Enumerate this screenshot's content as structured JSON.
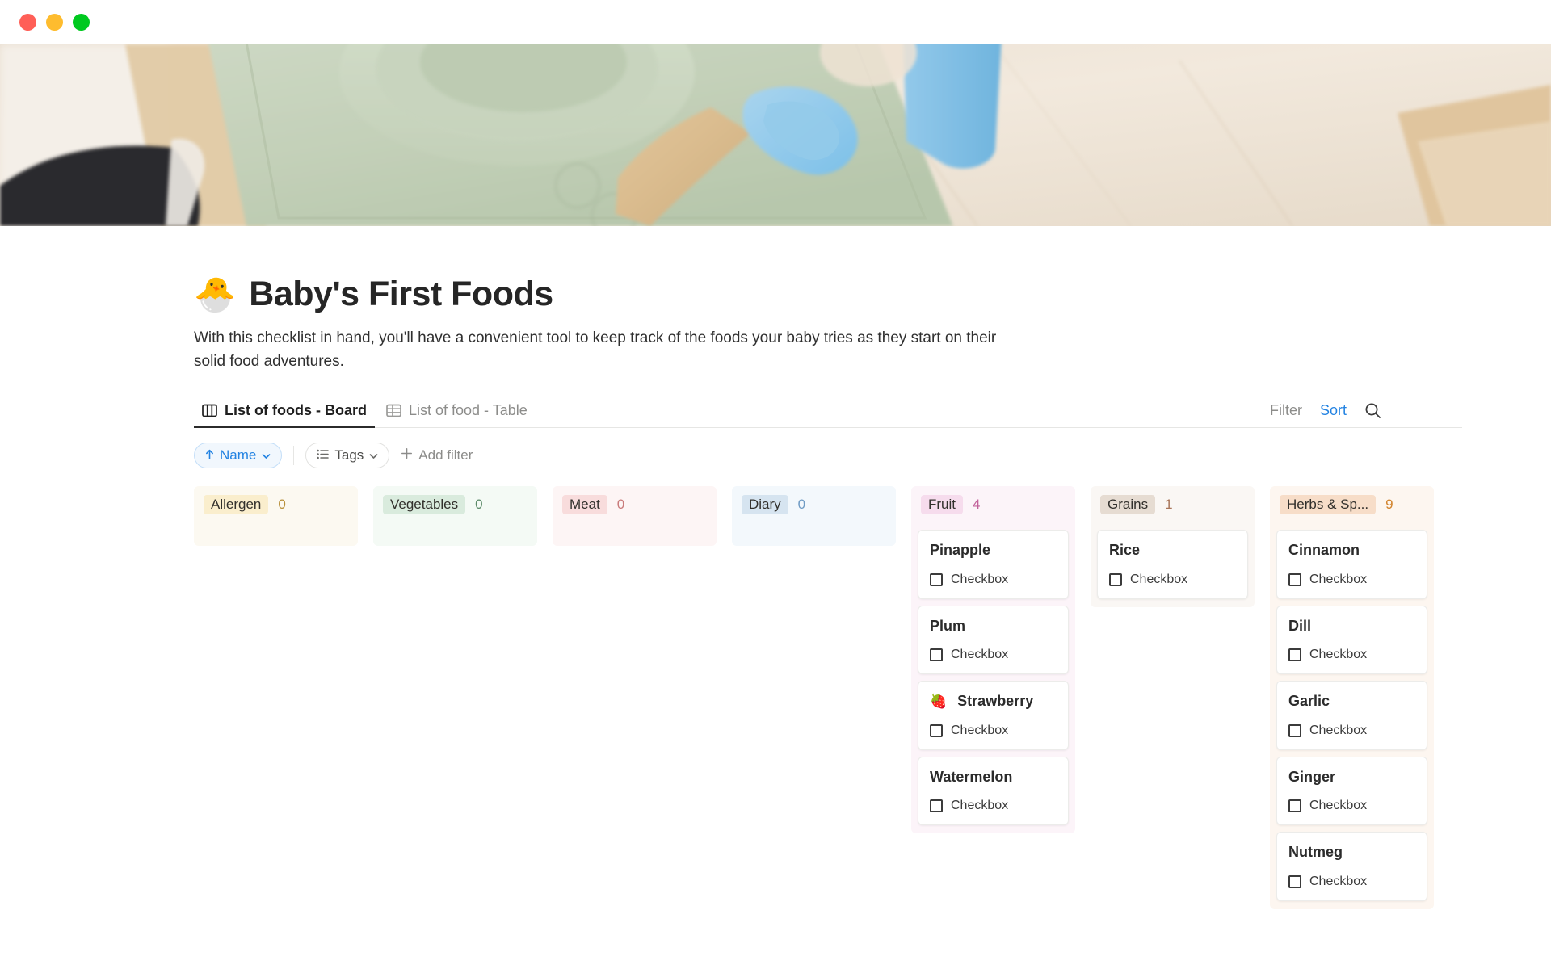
{
  "window": {
    "traffic_lights": [
      {
        "name": "close",
        "color": "#ff5f57"
      },
      {
        "name": "minimize",
        "color": "#febc2e"
      },
      {
        "name": "maximize",
        "color": "#00c91f"
      }
    ]
  },
  "header": {
    "emoji": "🐣",
    "title": "Baby's First Foods",
    "description": "With this checklist in hand, you'll have a convenient tool to keep track of the foods your baby tries as they start on their solid food adventures."
  },
  "tabs": [
    {
      "label": "List of foods - Board",
      "icon": "board-icon",
      "active": true
    },
    {
      "label": "List of food - Table",
      "icon": "table-icon",
      "active": false
    }
  ],
  "view_actions": {
    "filter_label": "Filter",
    "sort_label": "Sort",
    "search_icon": "search-icon",
    "accent_color": "#2383e2"
  },
  "filter_bar": {
    "sort_pill": {
      "label": "Name",
      "prefix_icon": "arrow-up-icon",
      "suffix_icon": "chevron-down-icon"
    },
    "group_pill": {
      "label": "Tags",
      "prefix_icon": "list-icon",
      "suffix_icon": "chevron-down-icon"
    },
    "add_filter": {
      "label": "Add filter",
      "icon": "plus-icon"
    }
  },
  "board": {
    "checkbox_label": "Checkbox",
    "columns": [
      {
        "name": "Allergen",
        "count": "0",
        "chip_bg": "#faeecd",
        "count_color": "#b8903a",
        "head_bg": "#fcf9f1",
        "body_bg": "#fcf9f1",
        "cards": []
      },
      {
        "name": "Vegetables",
        "count": "0",
        "chip_bg": "#d9ebdd",
        "count_color": "#5c8a69",
        "head_bg": "#f4faf5",
        "body_bg": "#f4faf5",
        "cards": []
      },
      {
        "name": "Meat",
        "count": "0",
        "chip_bg": "#f8dcdc",
        "count_color": "#c97b7b",
        "head_bg": "#fdf5f5",
        "body_bg": "#fdf5f5",
        "cards": []
      },
      {
        "name": "Diary",
        "count": "0",
        "chip_bg": "#d6e4f0",
        "count_color": "#6f9bc4",
        "head_bg": "#f3f8fc",
        "body_bg": "#f3f8fc",
        "cards": []
      },
      {
        "name": "Fruit",
        "count": "4",
        "chip_bg": "#f6dced",
        "count_color": "#c2629b",
        "head_bg": "#fcf4f9",
        "body_bg": "#fcf4f9",
        "cards": [
          {
            "title": "Pinapple",
            "emoji": ""
          },
          {
            "title": "Plum",
            "emoji": ""
          },
          {
            "title": "Strawberry",
            "emoji": "🍓"
          },
          {
            "title": "Watermelon",
            "emoji": ""
          }
        ]
      },
      {
        "name": "Grains",
        "count": "1",
        "chip_bg": "#e6dcd2",
        "count_color": "#a9765a",
        "head_bg": "#faf7f4",
        "body_bg": "#faf7f4",
        "cards": [
          {
            "title": "Rice",
            "emoji": ""
          }
        ]
      },
      {
        "name": "Herbs & Sp...",
        "count": "9",
        "chip_bg": "#f7ddc8",
        "count_color": "#d2842e",
        "head_bg": "#fdf6f0",
        "body_bg": "#fdf6f0",
        "cards": [
          {
            "title": "Cinnamon",
            "emoji": ""
          },
          {
            "title": "Dill",
            "emoji": ""
          },
          {
            "title": "Garlic",
            "emoji": ""
          },
          {
            "title": "Ginger",
            "emoji": ""
          },
          {
            "title": "Nutmeg",
            "emoji": ""
          }
        ]
      }
    ]
  }
}
